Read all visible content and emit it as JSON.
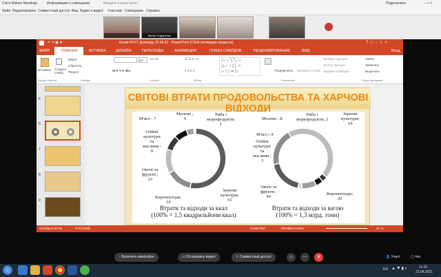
{
  "webex": {
    "title": "Cisco Webex Meetings",
    "info_tab": "Информация о совещании",
    "search_placeholder": "Введите строку меню",
    "connected": "Подключено",
    "menu": [
      "Файл",
      "Редактировать",
      "Совместный доступ",
      "Вид",
      "Аудио и видео",
      "Участник",
      "Совещание",
      "Справка"
    ],
    "participants": [
      "",
      "Віктор Сидоренко",
      "",
      "",
      ""
    ]
  },
  "ppt": {
    "window_title": "Ексив НУХТ Доповідь 22.04.21 - PowerPoint (Сбой активации продукта)",
    "tabs": [
      "ФАЙЛ",
      "ГЛАВНАЯ",
      "ВСТАВКА",
      "ДИЗАЙН",
      "ПЕРЕХОДЫ",
      "АНИМАЦИЯ",
      "ПОКАЗ СЛАЙДОВ",
      "РЕЦЕНЗИРОВАНИЕ",
      "ВИД"
    ],
    "signin": "Вход",
    "ribbon": {
      "paste": "Вставить",
      "create_slide": "Создать слайд",
      "layout": "Макет",
      "reset": "Сбросить",
      "section": "Раздел",
      "arrange": "Упорядочить",
      "quick_styles": "Экспресс-стили",
      "fill": "Заливка фигуры",
      "outline": "Контур фигуры",
      "effects": "Эффекты фигуры",
      "find": "Найти",
      "replace": "Заменить",
      "select": "Выделить",
      "font_size": "24",
      "groups": [
        "Буфер обмена",
        "Слайды",
        "Шрифт",
        "Абзац",
        "Рисование",
        "Редактирование"
      ]
    },
    "thumb_numbers": [
      "5",
      "6",
      "7",
      "8",
      "9"
    ],
    "status": {
      "slide": "СЛАЙД 6 ИЗ 55",
      "lang": "РУССКИЙ",
      "notes": "ЗАМЕТКИ",
      "comments": "ПРИМЕЧАНИЯ",
      "zoom": "57 %"
    }
  },
  "slide": {
    "title": "СВІТОВІ ВТРАТИ ПРОДОВОЛЬСТВА ТА ХАРЧОВІ ВІДХОДИ",
    "left": {
      "labels": [
        "М'ясо ; 7",
        "Молоко ;\n4",
        "Риба і\nморепродукти;\n1",
        "Олійні\nкультури\nта\nмаслини ;\n8",
        "Овочі та\nфрукти ;\n13",
        "Коренеплоди;\n14",
        "Зернові\nкультури;\n53"
      ],
      "caption": "Втрати та відходи за ккал\n(100% = 1,5 квадрильйони ккал)"
    },
    "right": {
      "labels": [
        "Молоко ; 8",
        "Риба і\nморепродукти; 2",
        "Зернові\nкультури;\n19",
        "М'ясо ; 4",
        "Олійні\nкультури\nта\nмаслини ;\n3",
        "Овочі та\nфрукти ;\n44",
        "Коренеплоди;\n20"
      ],
      "caption": "Втрати та відходи за вагою\n(100% = 1,3 млрд. тонн)"
    }
  },
  "chart_data": [
    {
      "type": "pie",
      "title": "Втрати та відходи за ккал (100% = 1,5 квадрильйони ккал)",
      "categories": [
        "Зернові культури",
        "Коренеплоди",
        "Овочі та фрукти",
        "Олійні культури та маслини",
        "М'ясо",
        "Молоко",
        "Риба і морепродукти"
      ],
      "values": [
        53,
        14,
        13,
        8,
        7,
        4,
        1
      ],
      "colors": [
        "#5a5a5a",
        "#8c8c8c",
        "#bcbcbc",
        "#3a3a3a",
        "#111111",
        "#a0a0a0",
        "#d8d8d8"
      ]
    },
    {
      "type": "pie",
      "title": "Втрати та відходи за вагою (100% = 1,3 млрд. тонн)",
      "categories": [
        "Зернові культури",
        "Коренеплоди",
        "Овочі та фрукти",
        "Олійні культури та маслини",
        "М'ясо",
        "Молоко",
        "Риба і морепродукти"
      ],
      "values": [
        19,
        20,
        44,
        3,
        4,
        8,
        2
      ],
      "colors": [
        "#5a5a5a",
        "#8c8c8c",
        "#bcbcbc",
        "#3a3a3a",
        "#111111",
        "#a0a0a0",
        "#d8d8d8"
      ]
    }
  ],
  "controls": {
    "mic": "Включить микрофон",
    "video": "Остановить видео",
    "share": "Совместный доступ",
    "participants": "Участ",
    "chat": "Чат"
  },
  "taskbar": {
    "lang": "EN",
    "time": "11:22",
    "date": "22.04.2021"
  }
}
